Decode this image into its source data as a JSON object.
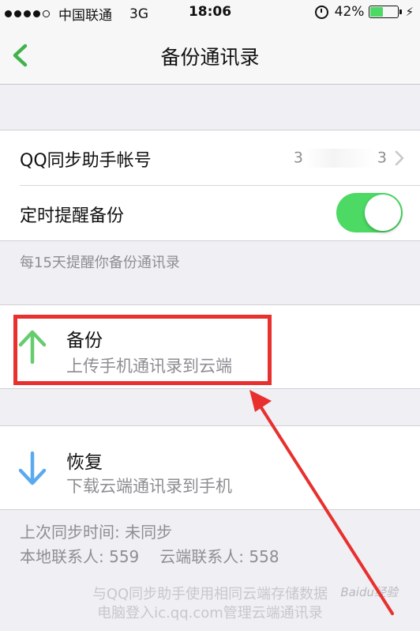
{
  "status_bar": {
    "carrier": "中国联通",
    "network": "3G",
    "time": "18:06",
    "battery": "42%",
    "battery_level": 0.42,
    "signal_bars": 4,
    "signal_max": 5
  },
  "nav": {
    "title": "备份通讯录",
    "back_icon": "chevron-left-icon"
  },
  "settings": {
    "account_label": "QQ同步助手帐号",
    "account_value_start": "3",
    "account_value_end": "3",
    "reminder_label": "定时提醒备份",
    "reminder_enabled": true,
    "reminder_note": "每15天提醒你备份通讯录"
  },
  "backup": {
    "title": "备份",
    "subtitle": "上传手机通讯录到云端",
    "icon": "arrow-up-icon"
  },
  "restore": {
    "title": "恢复",
    "subtitle": "下载云端通讯录到手机",
    "icon": "arrow-down-icon"
  },
  "sync_info": {
    "last_sync": "上次同步时间: 未同步",
    "local_contacts": "本地联系人: 559",
    "cloud_contacts": "云端联系人: 558"
  },
  "bottom_note": {
    "line1": "与QQ同步助手使用相同云端存储数据",
    "line2": "电脑登入ic.qq.com管理云端通讯录"
  },
  "watermark": "Baidu经验",
  "colors": {
    "accent_green": "#4cd964",
    "back_green": "#41b34a",
    "arrow_up_green": "#66cc6e",
    "arrow_down_blue": "#5aaaf0",
    "annotation_red": "#e8302e"
  }
}
